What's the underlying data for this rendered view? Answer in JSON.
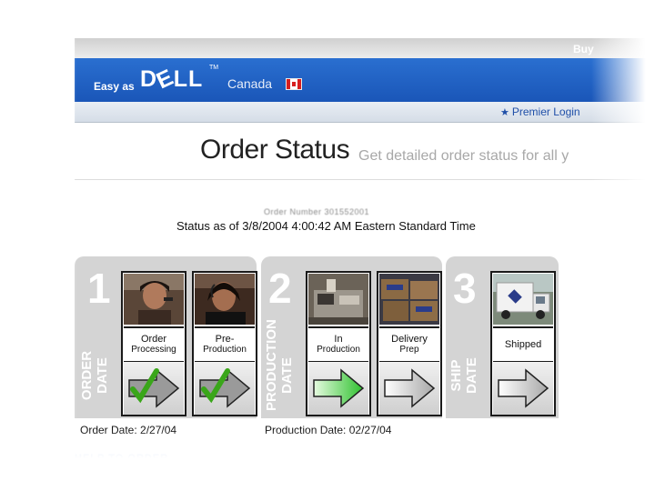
{
  "header": {
    "buy_link": "Buy",
    "tagline": "Easy as",
    "logo_text": "DELL",
    "trademark": "TM",
    "country": "Canada",
    "premier_login": "Premier Login"
  },
  "page": {
    "title": "Order Status",
    "subtitle": "Get detailed order status for all y",
    "order_number": "Order Number 301552001",
    "status_line": "Status as of 3/8/2004 4:00:42 AM Eastern Standard Time"
  },
  "stages": [
    {
      "number": "1",
      "label_line1": "ORDER",
      "label_line2": "DATE"
    },
    {
      "number": "2",
      "label_line1": "PRODUCTION",
      "label_line2": "DATE"
    },
    {
      "number": "3",
      "label_line1": "SHIP",
      "label_line2": "DATE"
    }
  ],
  "steps": [
    {
      "line1": "Order",
      "line2": "Processing",
      "state": "complete",
      "icon": "checkmark-icon"
    },
    {
      "line1": "Pre-",
      "line2": "Production",
      "state": "complete",
      "icon": "checkmark-icon"
    },
    {
      "line1": "In",
      "line2": "Production",
      "state": "current",
      "icon": "green-arrow-icon"
    },
    {
      "line1": "Delivery",
      "line2": "Prep",
      "state": "pending",
      "icon": "grey-arrow-icon"
    },
    {
      "line1": "Shipped",
      "line2": "",
      "state": "pending",
      "icon": "grey-arrow-icon"
    }
  ],
  "dates": {
    "order": "Order Date:  2/27/04",
    "production": "Production Date: 02/27/04"
  },
  "footer": {
    "link": "HELP TO ORDER"
  },
  "colors": {
    "brand_blue": "#1a56b8",
    "progress_green": "#2fc12f",
    "check_green": "#3aa61a"
  }
}
